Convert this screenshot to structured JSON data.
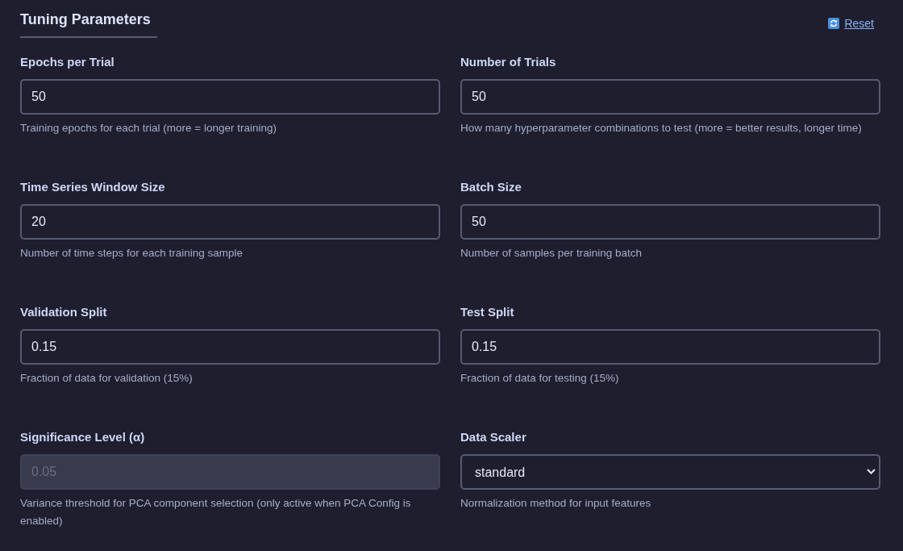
{
  "section": {
    "title": "Tuning Parameters",
    "reset_link": "Reset"
  },
  "fields": [
    {
      "label": "Epochs per Trial",
      "kind": "number",
      "value": "50",
      "disabled": false,
      "help": "Training epochs for each trial (more = longer training)"
    },
    {
      "label": "Number of Trials",
      "kind": "number",
      "value": "50",
      "disabled": false,
      "help": "How many hyperparameter combinations to test (more = better results, longer time)"
    },
    {
      "label": "Time Series Window Size",
      "kind": "number",
      "value": "20",
      "disabled": false,
      "help": "Number of time steps for each training sample"
    },
    {
      "label": "Batch Size",
      "kind": "number",
      "value": "50",
      "disabled": false,
      "help": "Number of samples per training batch"
    },
    {
      "label": "Validation Split",
      "kind": "number",
      "value": "0.15",
      "disabled": false,
      "help": "Fraction of data for validation (15%)"
    },
    {
      "label": "Test Split",
      "kind": "number",
      "value": "0.15",
      "disabled": false,
      "help": "Fraction of data for testing (15%)"
    },
    {
      "label": "Significance Level (α)",
      "kind": "number",
      "value": "0.05",
      "disabled": true,
      "help": "Variance threshold for PCA component selection (only active when PCA Config is enabled)"
    },
    {
      "label": "Data Scaler",
      "kind": "select",
      "value": "standard",
      "disabled": false,
      "help": "Normalization method for input features"
    }
  ]
}
